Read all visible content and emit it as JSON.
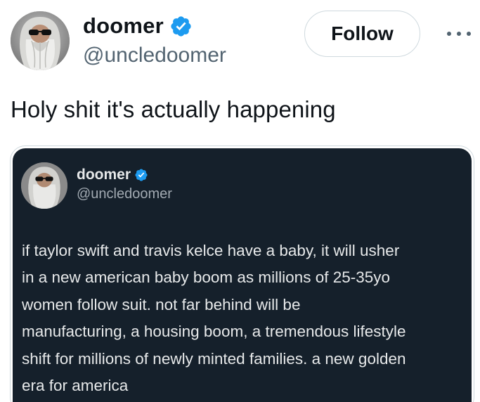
{
  "tweet": {
    "author": {
      "display_name": "doomer",
      "handle": "@uncledoomer",
      "verified_icon": "verified-badge-icon"
    },
    "follow_label": "Follow",
    "more_icon": "more-horizontal-icon",
    "text": "Holy shit it's actually happening"
  },
  "quoted": {
    "author": {
      "display_name": "doomer",
      "handle": "@uncledoomer"
    },
    "lines": [
      "if taylor swift and travis kelce have a baby, it will usher",
      "in a new american baby boom as millions of 25-35yo",
      "women follow suit. not far behind will be",
      "manufacturing, a housing boom, a tremendous lifestyle",
      "shift for millions of newly minted families. a new golden",
      "era for america"
    ]
  },
  "colors": {
    "verified": "#1d9bf0",
    "text_primary": "#0f1419",
    "text_secondary": "#536471",
    "quote_background": "#15202b"
  }
}
